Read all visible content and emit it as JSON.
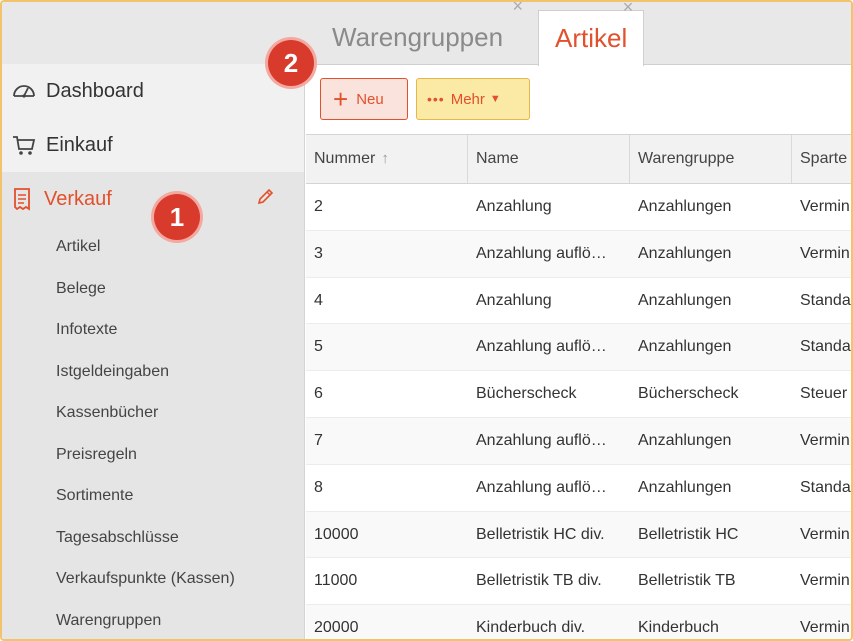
{
  "tabs": [
    {
      "label": "Warengruppen",
      "active": false
    },
    {
      "label": "Artikel",
      "active": true
    }
  ],
  "tab_close_glyph": "×",
  "sidebar": {
    "top_items": [
      {
        "label": "Dashboard",
        "icon": "dashboard-gauge-icon"
      },
      {
        "label": "Einkauf",
        "icon": "shopping-cart-icon"
      }
    ],
    "active_section": {
      "label": "Verkauf",
      "icon": "receipt-icon"
    },
    "sub_items": [
      "Artikel",
      "Belege",
      "Infotexte",
      "Istgeldeingaben",
      "Kassenbücher",
      "Preisregeln",
      "Sortimente",
      "Tagesabschlüsse",
      "Verkaufspunkte (Kassen)",
      "Warengruppen"
    ]
  },
  "badges": {
    "one": "1",
    "two": "2"
  },
  "toolbar": {
    "new_label": "Neu",
    "new_icon": "+",
    "more_label": "Mehr",
    "more_dots": "•••",
    "more_caret": "▼"
  },
  "table": {
    "columns": [
      "Nummer",
      "Name",
      "Warengruppe",
      "Sparte"
    ],
    "sort_indicator": "↑",
    "rows": [
      [
        "2",
        "Anzahlung",
        "Anzahlungen",
        "Vermin"
      ],
      [
        "3",
        "Anzahlung auflö…",
        "Anzahlungen",
        "Vermin"
      ],
      [
        "4",
        "Anzahlung",
        "Anzahlungen",
        "Standa"
      ],
      [
        "5",
        "Anzahlung auflö…",
        "Anzahlungen",
        "Standa"
      ],
      [
        "6",
        "Bücherscheck",
        "Bücherscheck",
        "Steuer"
      ],
      [
        "7",
        "Anzahlung auflö…",
        "Anzahlungen",
        "Vermin"
      ],
      [
        "8",
        "Anzahlung auflö…",
        "Anzahlungen",
        "Standa"
      ],
      [
        "10000",
        "Belletristik HC div.",
        "Belletristik HC",
        "Vermin"
      ],
      [
        "11000",
        "Belletristik TB div.",
        "Belletristik TB",
        "Vermin"
      ],
      [
        "20000",
        "Kinderbuch div.",
        "Kinderbuch",
        "Vermin"
      ]
    ]
  },
  "colors": {
    "accent": "#e2502c",
    "badge": "#d83a2c",
    "frame": "#f2c36b",
    "mehr_bg": "#fbe9a6"
  }
}
